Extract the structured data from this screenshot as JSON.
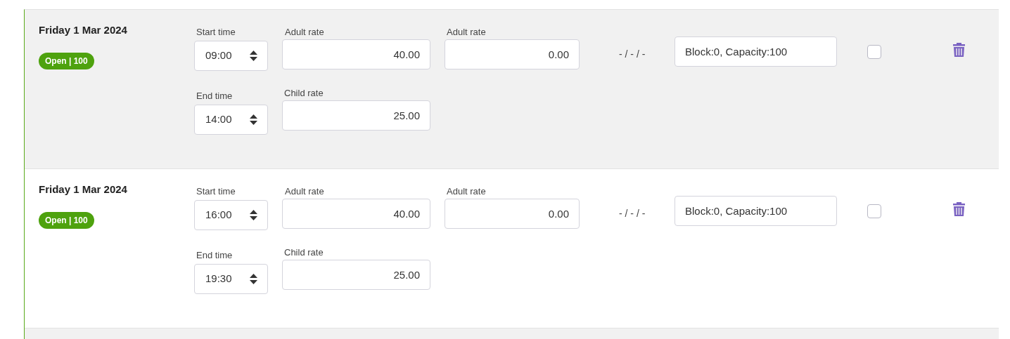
{
  "rows": [
    {
      "date": "Friday 1 Mar 2024",
      "badge": {
        "text": "Open | 100",
        "color": "#4ea20e"
      },
      "start_time": {
        "label": "Start time",
        "value": "09:00"
      },
      "end_time": {
        "label": "End time",
        "value": "14:00"
      },
      "adult_rate": {
        "label": "Adult rate",
        "value": "40.00"
      },
      "child_rate": {
        "label": "Child rate",
        "value": "25.00"
      },
      "adult_rate_2": {
        "label": "Adult rate",
        "value": "0.00"
      },
      "dashes": "- / - / -",
      "block": {
        "value": "Block:0, Capacity:100"
      },
      "checked": false
    },
    {
      "date": "Friday 1 Mar 2024",
      "badge": {
        "text": "Open | 100",
        "color": "#4ea20e"
      },
      "start_time": {
        "label": "Start time",
        "value": "16:00"
      },
      "end_time": {
        "label": "End time",
        "value": "19:30"
      },
      "adult_rate": {
        "label": "Adult rate",
        "value": "40.00"
      },
      "child_rate": {
        "label": "Child rate",
        "value": "25.00"
      },
      "adult_rate_2": {
        "label": "Adult rate",
        "value": "0.00"
      },
      "dashes": "- / - / -",
      "block": {
        "value": "Block:0, Capacity:100"
      },
      "checked": false
    }
  ]
}
